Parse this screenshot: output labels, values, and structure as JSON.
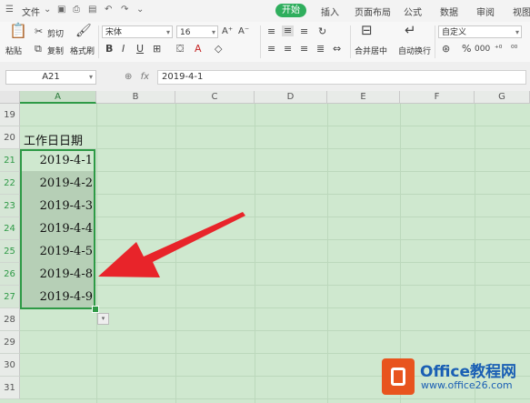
{
  "menu": {
    "file_label": "文件",
    "tabs": [
      "开始",
      "插入",
      "页面布局",
      "公式",
      "数据",
      "审阅",
      "视图"
    ],
    "active_tab": "开始"
  },
  "ribbon": {
    "paste_label": "粘贴",
    "cut_label": "剪切",
    "copy_label": "复制",
    "format_painter_label": "格式刷",
    "font_name": "宋体",
    "font_size": "16",
    "merge_label": "合并居中",
    "wrap_label": "自动换行",
    "number_format": "自定义"
  },
  "formula_bar": {
    "name_box": "A21",
    "fx_label": "fx",
    "content": "2019-4-1"
  },
  "sheet": {
    "columns": [
      "A",
      "B",
      "C",
      "D",
      "E",
      "F",
      "G"
    ],
    "selected_column": "A",
    "rows": [
      "19",
      "20",
      "21",
      "22",
      "23",
      "24",
      "25",
      "26",
      "27",
      "28",
      "29",
      "30",
      "31"
    ],
    "header_cell": "工作日日期",
    "dates": [
      "2019-4-1",
      "2019-4-2",
      "2019-4-3",
      "2019-4-4",
      "2019-4-5",
      "2019-4-8",
      "2019-4-9"
    ]
  },
  "watermark": {
    "name": "Office教程网",
    "url": "www.office26.com"
  },
  "colors": {
    "accent": "#2fae5d",
    "grid_bg": "#cfe8cf",
    "selection_border": "#2e9a46",
    "arrow": "#e8242a",
    "watermark_text": "#1a5fb4"
  }
}
